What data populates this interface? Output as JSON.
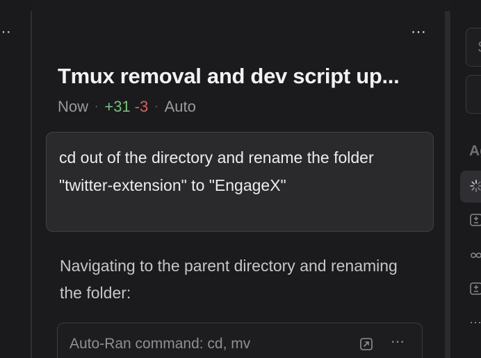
{
  "left_rail": {
    "more_label": "⋯"
  },
  "thread": {
    "more_label": "⋯",
    "title": "Tmux removal and dev script up...",
    "meta": {
      "time": "Now",
      "additions": "+31",
      "deletions": "-3",
      "mode": "Auto"
    },
    "prompt": "cd out of the directory and rename the folder \"twitter-extension\" to \"EngageX\"",
    "response": "Navigating to the parent directory and renaming the folder:",
    "command_card": {
      "label": "Auto-Ran command: cd, mv",
      "more_label": "⋯",
      "open_icon": "open-external-icon"
    }
  },
  "right_pane": {
    "field_char": "S",
    "heading": "Ag",
    "more_label": "⋯",
    "icons": [
      "loading-spinner-icon",
      "add-square-icon",
      "infinity-icon",
      "add-square-icon"
    ]
  }
}
